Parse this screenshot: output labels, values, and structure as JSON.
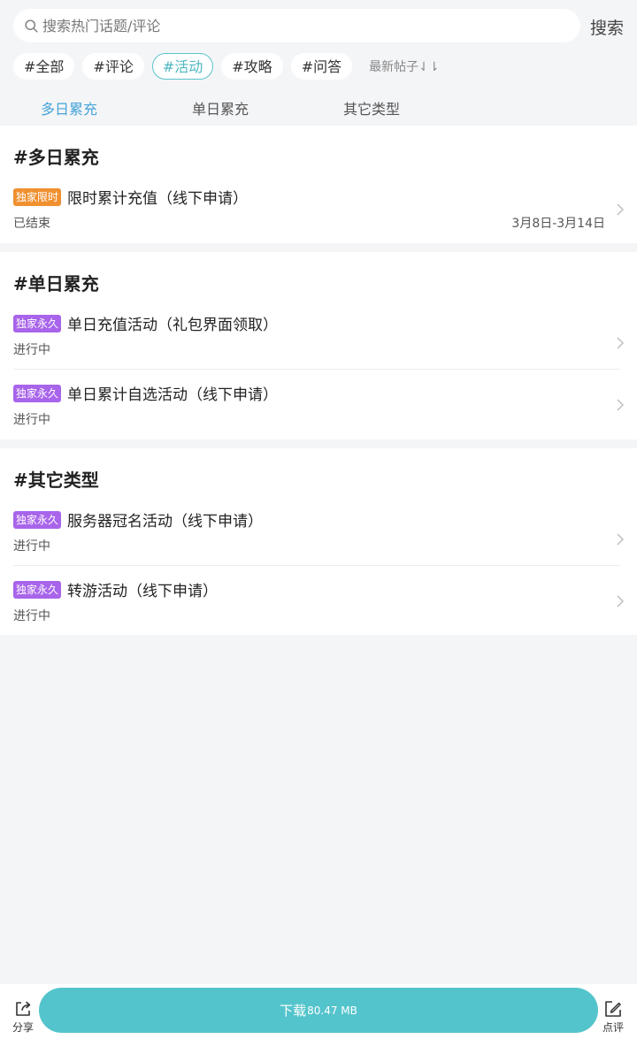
{
  "search": {
    "placeholder": "搜索热门话题/评论",
    "value": "",
    "button_label": "搜索"
  },
  "chips": [
    "#全部",
    "#评论",
    "#活动",
    "#攻略",
    "#问答"
  ],
  "active_chip": "#活动",
  "sort_label": "最新帖子⇃⇂",
  "tabs": [
    "多日累充",
    "单日累充",
    "其它类型"
  ],
  "active_tab": "多日累充",
  "sections": [
    {
      "title": "#多日累充",
      "items": [
        {
          "badge": "独家限时",
          "title": "限时累计充值（线下申请）",
          "status": "已结束",
          "date": "3月8日-3月14日"
        }
      ]
    },
    {
      "title": "#单日累充",
      "items": [
        {
          "badge": "独家永久",
          "title": "单日充值活动（礼包界面领取）",
          "status": "进行中"
        },
        {
          "badge": "独家永久",
          "title": "单日累计自选活动（线下申请）",
          "status": "进行中"
        }
      ]
    },
    {
      "title": "#其它类型",
      "items": [
        {
          "badge": "独家永久",
          "title": "服务器冠名活动（线下申请）",
          "status": "进行中"
        },
        {
          "badge": "独家永久",
          "title": "转游活动（线下申请）",
          "status": "进行中"
        }
      ]
    }
  ],
  "bottom": {
    "share_label": "分享",
    "download_label": "下载",
    "download_size": "80.47 MB",
    "review_label": "点评"
  },
  "colors": {
    "accent": "#54c4cc",
    "tab_active": "#46a4d9",
    "badge_limited": "#f0902f",
    "badge_permanent": "#a864ea"
  },
  "icons": {
    "search": "search-icon",
    "chevron": "chevron-right-icon",
    "share": "share-icon",
    "review": "edit-icon"
  }
}
